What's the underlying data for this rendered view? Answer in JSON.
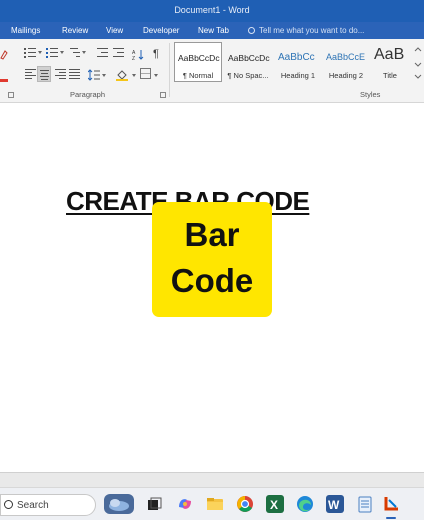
{
  "window": {
    "title": "Document1 - Word"
  },
  "menu": {
    "tabs": [
      "Mailings",
      "Review",
      "View",
      "Developer",
      "New Tab"
    ],
    "tell_me": "Tell me what you want to do..."
  },
  "ribbon": {
    "paragraph_group": "Paragraph",
    "styles_group": "Styles",
    "styles": [
      {
        "sample": "AaBbCcDc",
        "name": "¶ Normal"
      },
      {
        "sample": "AaBbCcDc",
        "name": "¶ No Spac..."
      },
      {
        "sample": "AaBbCc",
        "name": "Heading 1"
      },
      {
        "sample": "AaBbCcE",
        "name": "Heading 2"
      },
      {
        "sample": "AaB",
        "name": "Title"
      }
    ]
  },
  "document": {
    "heading": "CREATE BAR CODE",
    "badge_line1": "Bar",
    "badge_line2": "Code",
    "badge_color": "#ffe600"
  },
  "taskbar": {
    "search_label": "Search",
    "icons": [
      "widgets-icon",
      "task-view-icon",
      "copilot-icon",
      "file-explorer-icon",
      "chrome-icon",
      "excel-icon",
      "edge-icon",
      "word-icon",
      "notepad-icon",
      "snipping-tool-icon"
    ]
  },
  "colors": {
    "titlebar": "#1f5fb4",
    "menubar": "#2b63b8",
    "accent_heading": "#2e74b5"
  }
}
